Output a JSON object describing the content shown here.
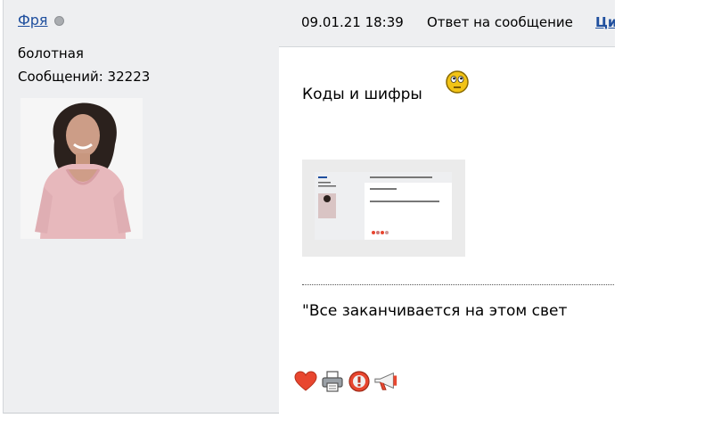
{
  "sidebar": {
    "username": "Фря",
    "user_title": "болотная",
    "posts_count": "Сообщений: 32223"
  },
  "post": {
    "date": "09.01.21 18:39",
    "reply_prefix": "Ответ на сообщение",
    "reply_link": "Ци",
    "body_text": "Коды и шифры",
    "signature": "\"Все заканчивается на этом свет"
  },
  "icons": {
    "status": "offline-dot-icon",
    "smiley": "eyes-rolling-smiley-icon",
    "actions": [
      "heart-icon",
      "print-icon",
      "warning-icon",
      "megaphone-icon"
    ]
  },
  "colors": {
    "link": "#1f4f9e",
    "panel": "#eeeff1",
    "heart": "#e8462f"
  }
}
